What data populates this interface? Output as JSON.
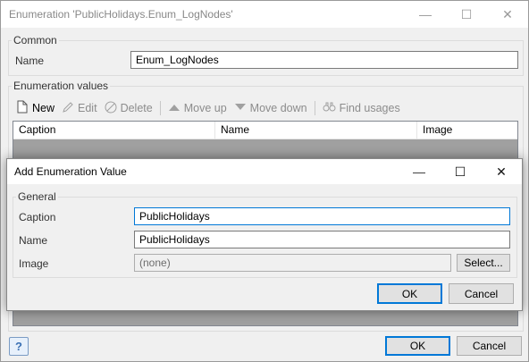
{
  "window": {
    "title": "Enumeration 'PublicHolidays.Enum_LogNodes'",
    "controls": {
      "minimize": "—",
      "maximize": "☐",
      "close": "✕"
    }
  },
  "common": {
    "legend": "Common",
    "name_label": "Name",
    "name_value": "Enum_LogNodes"
  },
  "enum_values": {
    "legend": "Enumeration values",
    "toolbar": {
      "new": "New",
      "edit": "Edit",
      "delete": "Delete",
      "move_up": "Move up",
      "move_down": "Move down",
      "find_usages": "Find usages"
    },
    "columns": [
      "Caption",
      "Name",
      "Image"
    ]
  },
  "footer": {
    "help": "?",
    "ok": "OK",
    "cancel": "Cancel"
  },
  "dialog": {
    "title": "Add Enumeration Value",
    "controls": {
      "minimize": "—",
      "maximize": "☐",
      "close": "✕"
    },
    "general_legend": "General",
    "caption_label": "Caption",
    "caption_value": "PublicHolidays",
    "name_label": "Name",
    "name_value": "PublicHolidays",
    "image_label": "Image",
    "image_value": "(none)",
    "select_button": "Select...",
    "ok": "OK",
    "cancel": "Cancel"
  },
  "colors": {
    "accent": "#0078d7",
    "grid_empty": "#a0a0a0",
    "disabled_text": "#8c8c8c"
  }
}
